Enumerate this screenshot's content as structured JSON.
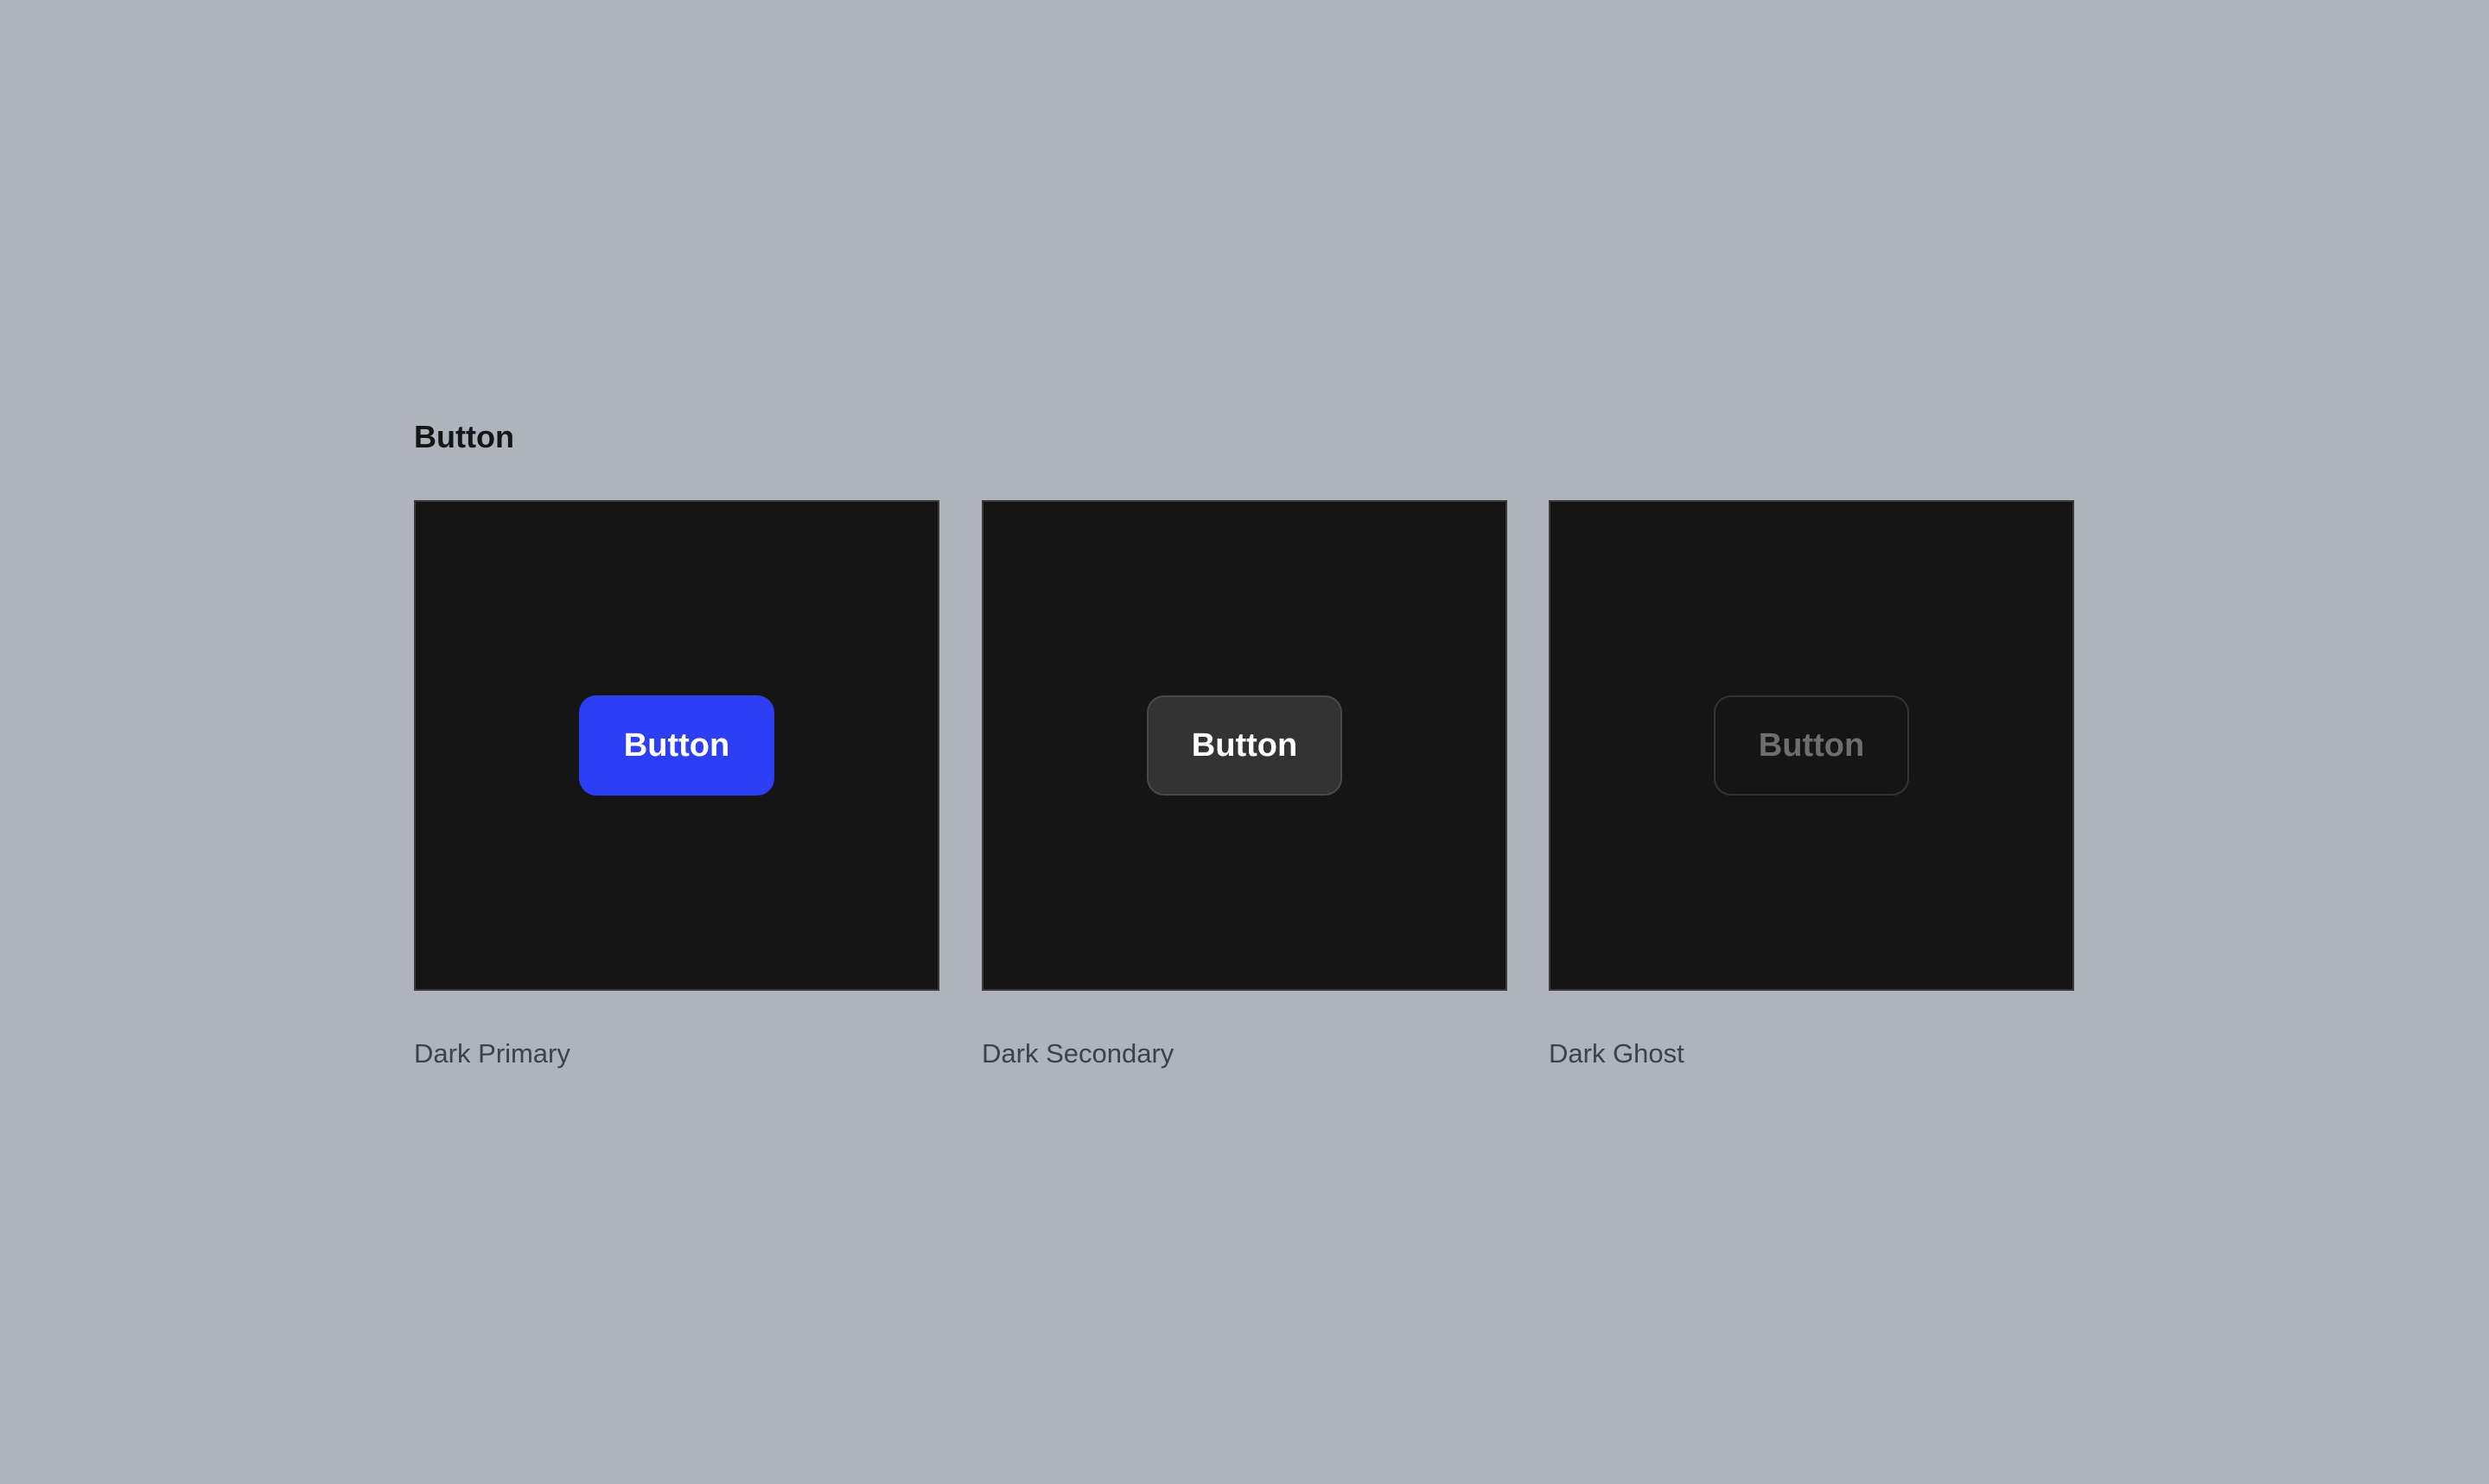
{
  "section": {
    "title": "Button"
  },
  "variants": [
    {
      "button_label": "Button",
      "caption": "Dark Primary",
      "button_color": "#2c3ff5"
    },
    {
      "button_label": "Button",
      "caption": "Dark Secondary",
      "button_color": "#333333"
    },
    {
      "button_label": "Button",
      "caption": "Dark Ghost",
      "button_color": "transparent"
    }
  ],
  "colors": {
    "page_background": "#adb4bc",
    "card_background": "#151515"
  }
}
